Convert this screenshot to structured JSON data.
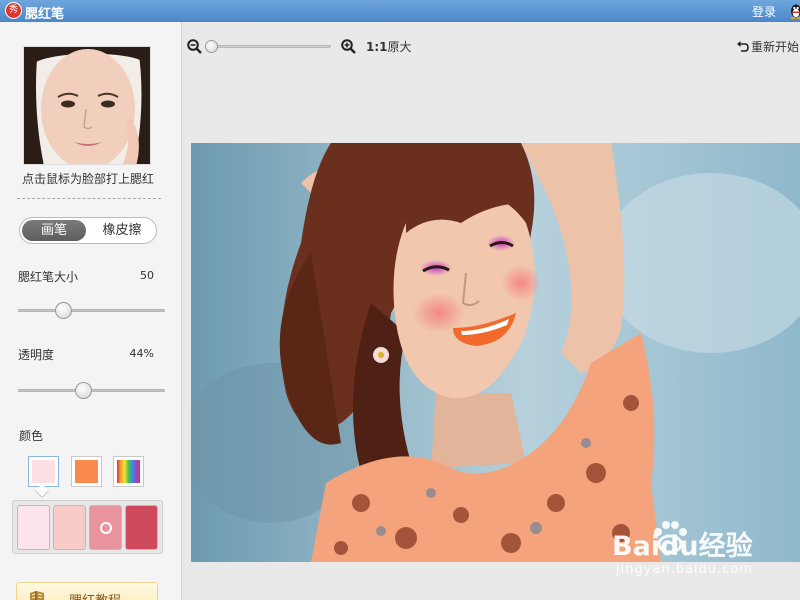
{
  "app": {
    "logo_text": "秀",
    "title": "腮红笔",
    "login_label": "登录",
    "qq_icon": "qq-penguin-icon"
  },
  "sidebar": {
    "face_image": "face-thumbnail",
    "hint": "点击鼠标为脸部打上腮红",
    "modes": {
      "brush_label": "画笔",
      "eraser_label": "橡皮擦",
      "active": "brush"
    },
    "brush_size": {
      "label": "腮红笔大小",
      "value": "50",
      "level": 0.3
    },
    "opacity": {
      "label": "透明度",
      "value": "44%",
      "level": 0.44
    },
    "color_label": "颜色",
    "color_tabs": [
      {
        "name": "preset-pink",
        "color": "#fde0e6",
        "selected": true
      },
      {
        "name": "orange",
        "color": "#f98a4e",
        "selected": false
      },
      {
        "name": "rainbow",
        "color": "rainbow",
        "selected": false
      }
    ],
    "palette": [
      {
        "color": "#fde4ea",
        "selected": false
      },
      {
        "color": "#f7cbc7",
        "selected": false
      },
      {
        "color": "#e9939f",
        "selected": true
      },
      {
        "color": "#d04a5e",
        "selected": false
      }
    ],
    "tutorial_label": "腮红教程",
    "tutorial_icon": "book-icon"
  },
  "toolbar": {
    "zoom_out_icon": "zoom-out-icon",
    "zoom_in_icon": "zoom-in-icon",
    "zoom_level": 0.0,
    "ratio_bold": "1:1",
    "ratio_text": "原大",
    "restart_label": "重新开始",
    "restart_icon": "undo-icon"
  },
  "canvas": {
    "photo": "woman-smiling-photo",
    "watermark_main": "Baidu经验",
    "watermark_sub": "jingyan.baidu.com"
  }
}
